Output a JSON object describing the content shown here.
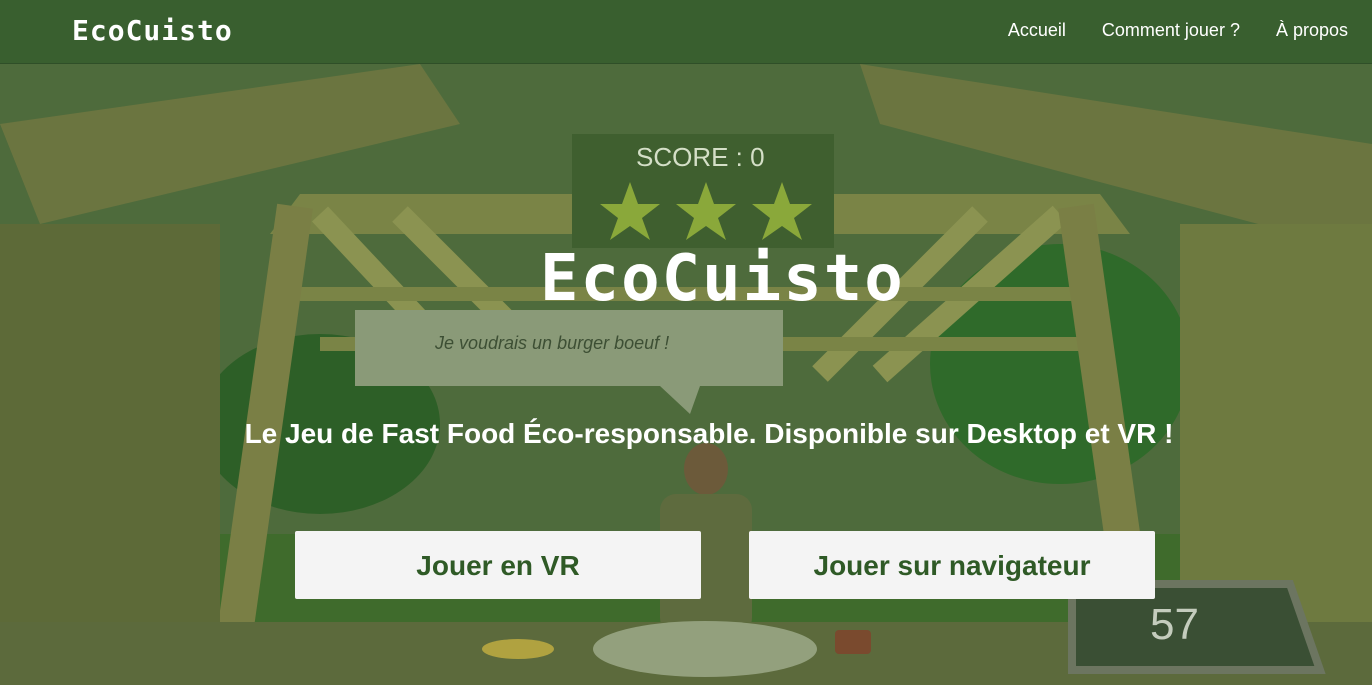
{
  "header": {
    "logo": "EcoCuisto",
    "nav": [
      "Accueil",
      "Comment jouer ?",
      "À propos"
    ]
  },
  "game": {
    "score": "SCORE : 0",
    "speech": "Je voudrais un burger boeuf !",
    "timer": "57"
  },
  "hero": {
    "title": "EcoCuisto",
    "subtitle": "Le Jeu de Fast Food Éco-responsable. Disponible sur Desktop et VR !",
    "buttons": [
      "Jouer en VR",
      "Jouer sur navigateur"
    ]
  },
  "colors": {
    "header_bg": "#395f2f",
    "overlay": "#4a6a3a",
    "button_bg": "#f4f4f4",
    "button_text": "#2f5a26"
  }
}
